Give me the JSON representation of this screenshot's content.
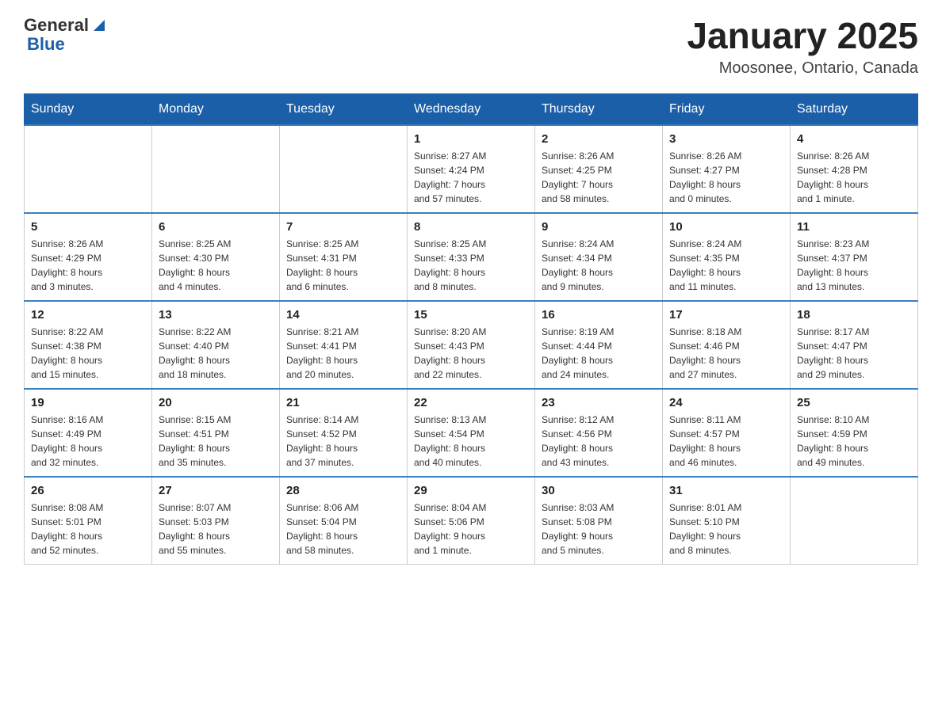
{
  "header": {
    "logo": {
      "general": "General",
      "blue": "Blue"
    },
    "title": "January 2025",
    "location": "Moosonee, Ontario, Canada"
  },
  "weekdays": [
    "Sunday",
    "Monday",
    "Tuesday",
    "Wednesday",
    "Thursday",
    "Friday",
    "Saturday"
  ],
  "weeks": [
    [
      {
        "day": "",
        "info": ""
      },
      {
        "day": "",
        "info": ""
      },
      {
        "day": "",
        "info": ""
      },
      {
        "day": "1",
        "info": "Sunrise: 8:27 AM\nSunset: 4:24 PM\nDaylight: 7 hours\nand 57 minutes."
      },
      {
        "day": "2",
        "info": "Sunrise: 8:26 AM\nSunset: 4:25 PM\nDaylight: 7 hours\nand 58 minutes."
      },
      {
        "day": "3",
        "info": "Sunrise: 8:26 AM\nSunset: 4:27 PM\nDaylight: 8 hours\nand 0 minutes."
      },
      {
        "day": "4",
        "info": "Sunrise: 8:26 AM\nSunset: 4:28 PM\nDaylight: 8 hours\nand 1 minute."
      }
    ],
    [
      {
        "day": "5",
        "info": "Sunrise: 8:26 AM\nSunset: 4:29 PM\nDaylight: 8 hours\nand 3 minutes."
      },
      {
        "day": "6",
        "info": "Sunrise: 8:25 AM\nSunset: 4:30 PM\nDaylight: 8 hours\nand 4 minutes."
      },
      {
        "day": "7",
        "info": "Sunrise: 8:25 AM\nSunset: 4:31 PM\nDaylight: 8 hours\nand 6 minutes."
      },
      {
        "day": "8",
        "info": "Sunrise: 8:25 AM\nSunset: 4:33 PM\nDaylight: 8 hours\nand 8 minutes."
      },
      {
        "day": "9",
        "info": "Sunrise: 8:24 AM\nSunset: 4:34 PM\nDaylight: 8 hours\nand 9 minutes."
      },
      {
        "day": "10",
        "info": "Sunrise: 8:24 AM\nSunset: 4:35 PM\nDaylight: 8 hours\nand 11 minutes."
      },
      {
        "day": "11",
        "info": "Sunrise: 8:23 AM\nSunset: 4:37 PM\nDaylight: 8 hours\nand 13 minutes."
      }
    ],
    [
      {
        "day": "12",
        "info": "Sunrise: 8:22 AM\nSunset: 4:38 PM\nDaylight: 8 hours\nand 15 minutes."
      },
      {
        "day": "13",
        "info": "Sunrise: 8:22 AM\nSunset: 4:40 PM\nDaylight: 8 hours\nand 18 minutes."
      },
      {
        "day": "14",
        "info": "Sunrise: 8:21 AM\nSunset: 4:41 PM\nDaylight: 8 hours\nand 20 minutes."
      },
      {
        "day": "15",
        "info": "Sunrise: 8:20 AM\nSunset: 4:43 PM\nDaylight: 8 hours\nand 22 minutes."
      },
      {
        "day": "16",
        "info": "Sunrise: 8:19 AM\nSunset: 4:44 PM\nDaylight: 8 hours\nand 24 minutes."
      },
      {
        "day": "17",
        "info": "Sunrise: 8:18 AM\nSunset: 4:46 PM\nDaylight: 8 hours\nand 27 minutes."
      },
      {
        "day": "18",
        "info": "Sunrise: 8:17 AM\nSunset: 4:47 PM\nDaylight: 8 hours\nand 29 minutes."
      }
    ],
    [
      {
        "day": "19",
        "info": "Sunrise: 8:16 AM\nSunset: 4:49 PM\nDaylight: 8 hours\nand 32 minutes."
      },
      {
        "day": "20",
        "info": "Sunrise: 8:15 AM\nSunset: 4:51 PM\nDaylight: 8 hours\nand 35 minutes."
      },
      {
        "day": "21",
        "info": "Sunrise: 8:14 AM\nSunset: 4:52 PM\nDaylight: 8 hours\nand 37 minutes."
      },
      {
        "day": "22",
        "info": "Sunrise: 8:13 AM\nSunset: 4:54 PM\nDaylight: 8 hours\nand 40 minutes."
      },
      {
        "day": "23",
        "info": "Sunrise: 8:12 AM\nSunset: 4:56 PM\nDaylight: 8 hours\nand 43 minutes."
      },
      {
        "day": "24",
        "info": "Sunrise: 8:11 AM\nSunset: 4:57 PM\nDaylight: 8 hours\nand 46 minutes."
      },
      {
        "day": "25",
        "info": "Sunrise: 8:10 AM\nSunset: 4:59 PM\nDaylight: 8 hours\nand 49 minutes."
      }
    ],
    [
      {
        "day": "26",
        "info": "Sunrise: 8:08 AM\nSunset: 5:01 PM\nDaylight: 8 hours\nand 52 minutes."
      },
      {
        "day": "27",
        "info": "Sunrise: 8:07 AM\nSunset: 5:03 PM\nDaylight: 8 hours\nand 55 minutes."
      },
      {
        "day": "28",
        "info": "Sunrise: 8:06 AM\nSunset: 5:04 PM\nDaylight: 8 hours\nand 58 minutes."
      },
      {
        "day": "29",
        "info": "Sunrise: 8:04 AM\nSunset: 5:06 PM\nDaylight: 9 hours\nand 1 minute."
      },
      {
        "day": "30",
        "info": "Sunrise: 8:03 AM\nSunset: 5:08 PM\nDaylight: 9 hours\nand 5 minutes."
      },
      {
        "day": "31",
        "info": "Sunrise: 8:01 AM\nSunset: 5:10 PM\nDaylight: 9 hours\nand 8 minutes."
      },
      {
        "day": "",
        "info": ""
      }
    ]
  ]
}
